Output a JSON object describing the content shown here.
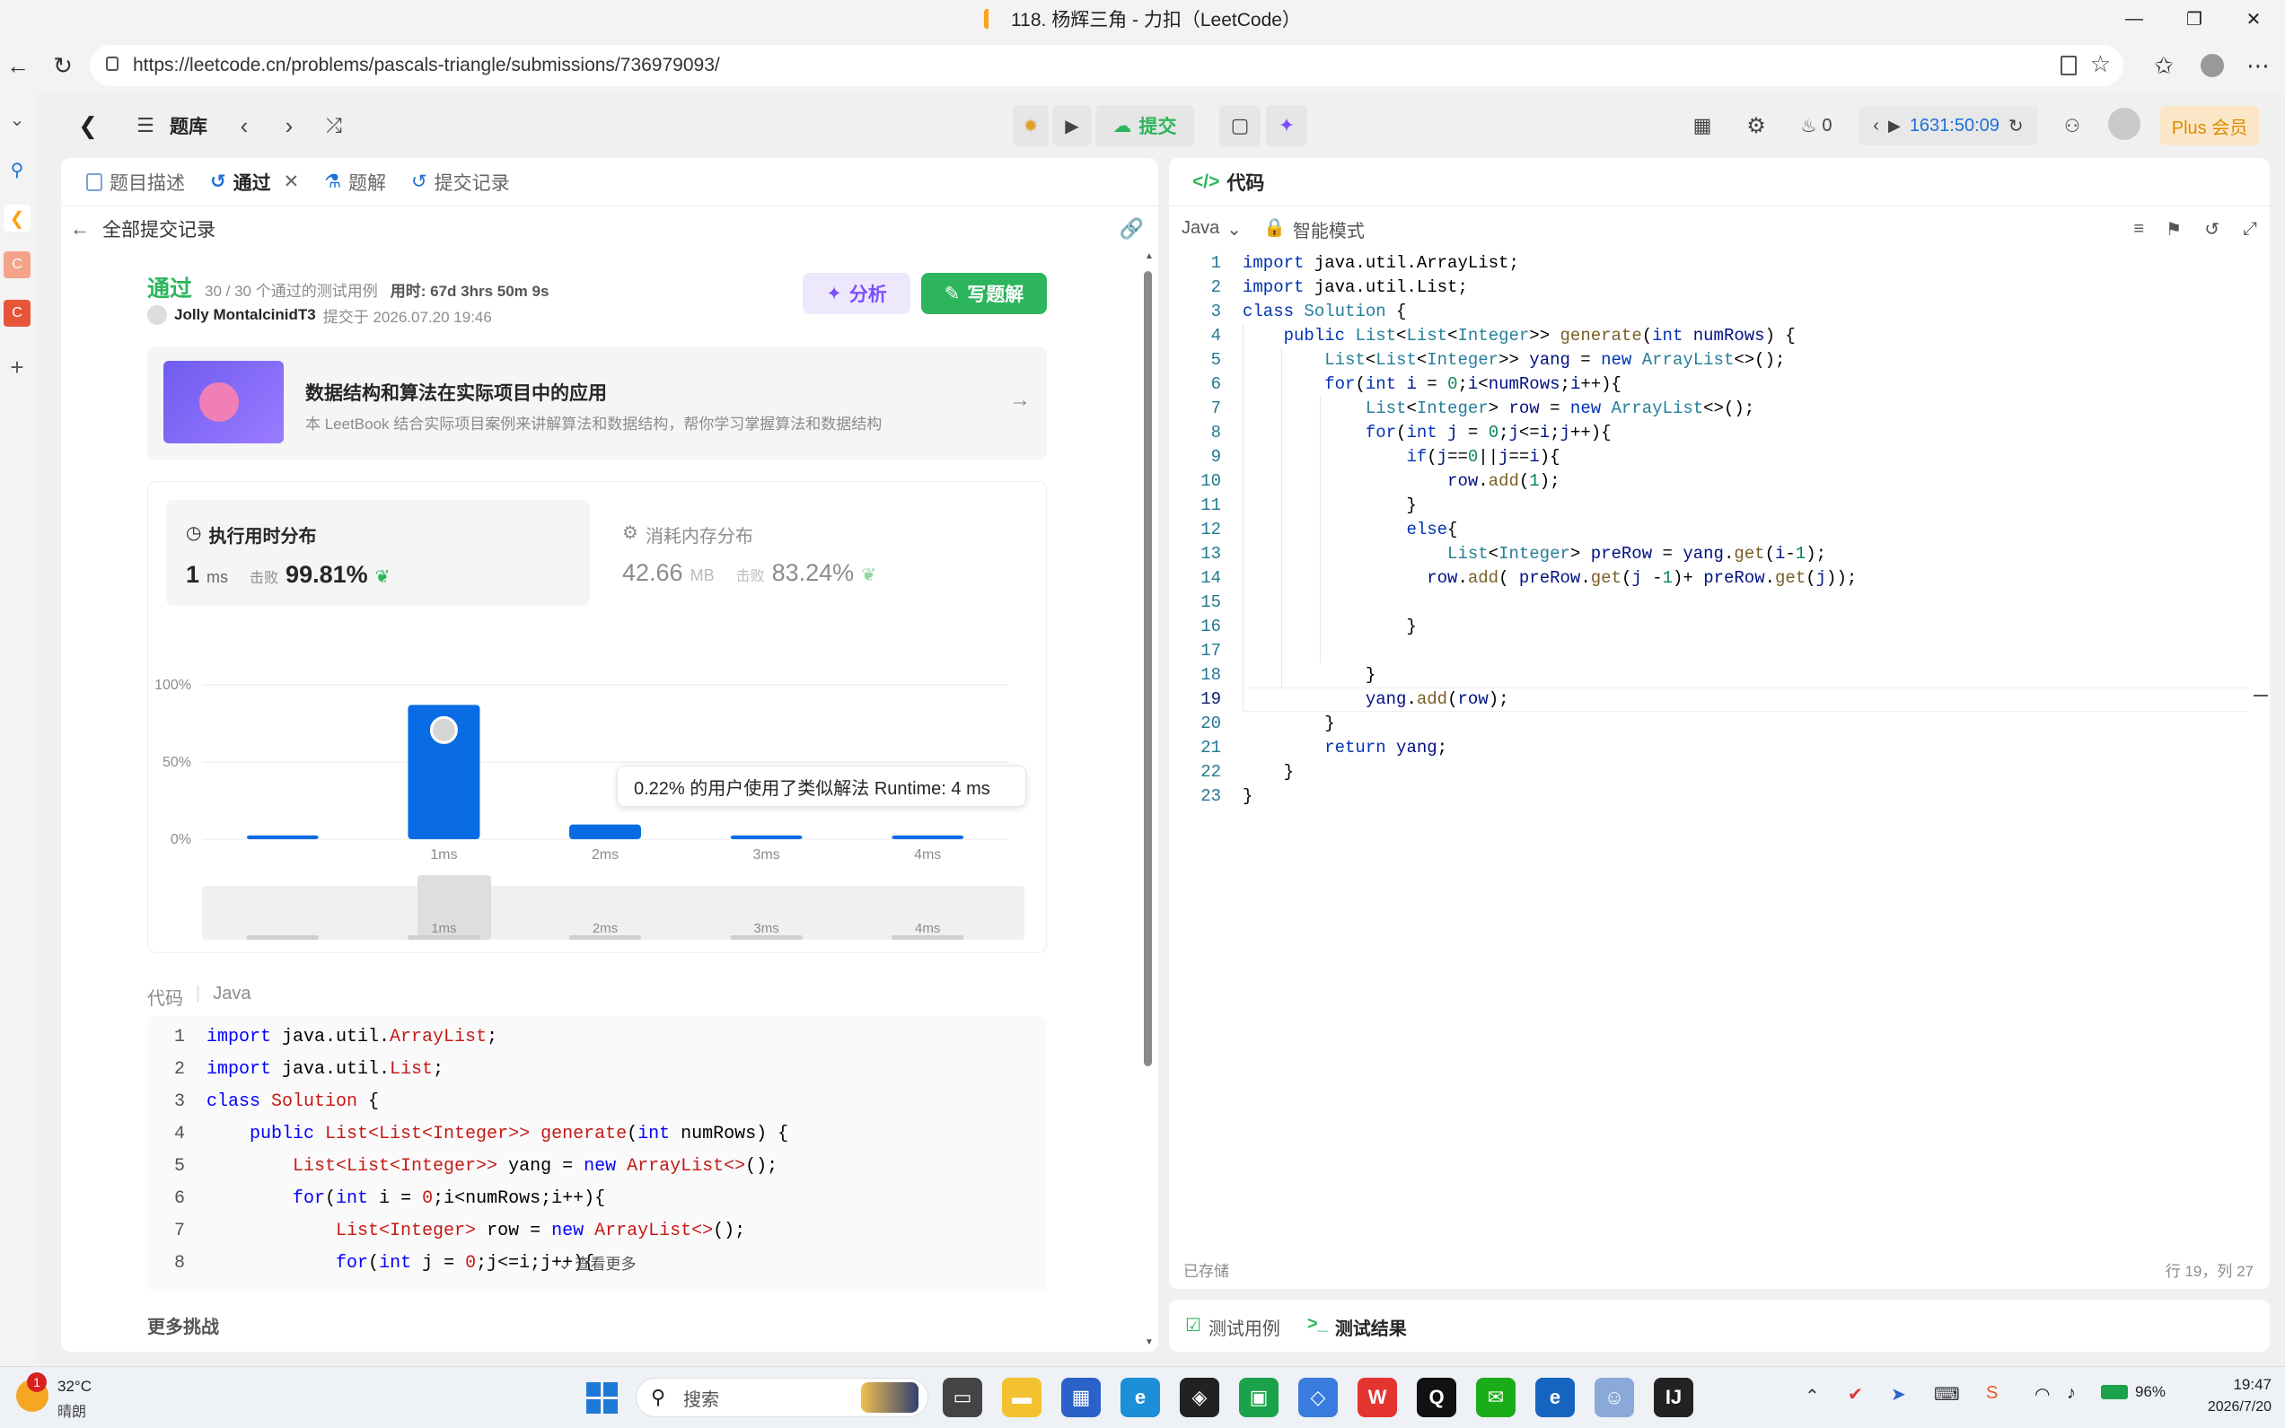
{
  "window": {
    "title": "118. 杨辉三角 - 力扣（LeetCode）"
  },
  "browser": {
    "url": "https://leetcode.cn/problems/pascals-triangle/submissions/736979093/"
  },
  "header": {
    "problem_list": "题库",
    "submit": "提交",
    "streak_count": "0",
    "timer": "1631:50:09",
    "plus": "Plus 会员"
  },
  "left_tabs": [
    {
      "label": "题目描述"
    },
    {
      "label": "通过"
    },
    {
      "label": "题解"
    },
    {
      "label": "提交记录"
    }
  ],
  "submission": {
    "back_label": "全部提交记录",
    "status": "通过",
    "tests": "30 / 30 个通过的测试用例",
    "duration": "用时: 67d 3hrs 50m 9s",
    "user": "Jolly MontalcinidT3",
    "submitted_at": "提交于 2026.07.20 19:46",
    "analyze": "分析",
    "write_solution": "写题解"
  },
  "banner": {
    "title": "数据结构和算法在实际项目中的应用",
    "desc": "本 LeetBook 结合实际项目案例来讲解算法和数据结构，帮你学习掌握算法和数据结构"
  },
  "runtime": {
    "title": "执行用时分布",
    "value": "1",
    "unit": "ms",
    "beat_label": "击败",
    "beat": "99.81%"
  },
  "memory": {
    "title": "消耗内存分布",
    "value": "42.66",
    "unit": "MB",
    "beat_label": "击败",
    "beat": "83.24%"
  },
  "tooltip": "0.22% 的用户使用了类似解法 Runtime: 4 ms",
  "chart_data": {
    "type": "bar",
    "categories": [
      "",
      "1ms",
      "2ms",
      "3ms",
      "4ms"
    ],
    "values": [
      2.5,
      87,
      9.5,
      2.5,
      2.5
    ],
    "y_ticks": [
      "100%",
      "50%",
      "0%"
    ],
    "ylim": [
      0,
      100
    ],
    "grid": true,
    "brush_labels": [
      "1ms",
      "2ms",
      "3ms",
      "4ms"
    ]
  },
  "code_section": {
    "label": "代码",
    "lang": "Java",
    "more": "查看更多"
  },
  "code_preview": [
    {
      "n": "1",
      "t": [
        [
          "kw",
          "import "
        ],
        [
          "pl",
          "java.util."
        ],
        [
          "ty",
          "ArrayList"
        ],
        [
          "pl",
          ";"
        ]
      ]
    },
    {
      "n": "2",
      "t": [
        [
          "kw",
          "import "
        ],
        [
          "pl",
          "java.util."
        ],
        [
          "ty",
          "List"
        ],
        [
          "pl",
          ";"
        ]
      ]
    },
    {
      "n": "3",
      "t": [
        [
          "kw",
          "class "
        ],
        [
          "ty",
          "Solution"
        ],
        [
          "pl",
          " {"
        ]
      ]
    },
    {
      "n": "4",
      "t": [
        [
          "pl",
          "    "
        ],
        [
          "kw",
          "public "
        ],
        [
          "ty",
          "List<List<Integer>> "
        ],
        [
          "ty",
          "generate"
        ],
        [
          "pl",
          "("
        ],
        [
          "kw",
          "int "
        ],
        [
          "pl",
          "numRows) {"
        ]
      ]
    },
    {
      "n": "5",
      "t": [
        [
          "pl",
          "        "
        ],
        [
          "ty",
          "List<List<Integer>> "
        ],
        [
          "pl",
          "yang = "
        ],
        [
          "kw",
          "new "
        ],
        [
          "ty",
          "ArrayList<>"
        ],
        [
          "pl",
          "();"
        ]
      ]
    },
    {
      "n": "6",
      "t": [
        [
          "pl",
          "        "
        ],
        [
          "kw",
          "for"
        ],
        [
          "pl",
          "("
        ],
        [
          "kw",
          "int "
        ],
        [
          "pl",
          "i = "
        ],
        [
          "ty",
          "0"
        ],
        [
          "pl",
          ";i<numRows;i++){"
        ]
      ]
    },
    {
      "n": "7",
      "t": [
        [
          "pl",
          "            "
        ],
        [
          "ty",
          "List<Integer> "
        ],
        [
          "pl",
          "row = "
        ],
        [
          "kw",
          "new "
        ],
        [
          "ty",
          "ArrayList<>"
        ],
        [
          "pl",
          "();"
        ]
      ]
    },
    {
      "n": "8",
      "t": [
        [
          "pl",
          "            "
        ],
        [
          "kw",
          "for"
        ],
        [
          "pl",
          "("
        ],
        [
          "kw",
          "int "
        ],
        [
          "pl",
          "j = "
        ],
        [
          "ty",
          "0"
        ],
        [
          "pl",
          ";j<=i;j++){"
        ]
      ]
    }
  ],
  "more_challenges": "更多挑战",
  "editor": {
    "tab": "代码",
    "lang": "Java",
    "mode": "智能模式",
    "saved": "已存储",
    "cursor": "行 19，列 27",
    "lines": [
      {
        "n": "1",
        "t": [
          [
            "kw2",
            "import "
          ],
          [
            "pl",
            "java.util.ArrayList;"
          ]
        ]
      },
      {
        "n": "2",
        "t": [
          [
            "kw2",
            "import "
          ],
          [
            "pl",
            "java.util.List;"
          ]
        ]
      },
      {
        "n": "3",
        "t": [
          [
            "kw2",
            "class "
          ],
          [
            "ty2",
            "Solution"
          ],
          [
            "pl",
            " {"
          ]
        ]
      },
      {
        "n": "4",
        "t": [
          [
            "pl",
            "    "
          ],
          [
            "kw2",
            "public "
          ],
          [
            "ty2",
            "List"
          ],
          [
            "pl",
            "<"
          ],
          [
            "ty2",
            "List"
          ],
          [
            "pl",
            "<"
          ],
          [
            "ty2",
            "Integer"
          ],
          [
            "pl",
            ">> "
          ],
          [
            "fn2",
            "generate"
          ],
          [
            "pl",
            "("
          ],
          [
            "kw2",
            "int "
          ],
          [
            "vr2",
            "numRows"
          ],
          [
            "pl",
            ") {"
          ]
        ]
      },
      {
        "n": "5",
        "t": [
          [
            "pl",
            "        "
          ],
          [
            "ty2",
            "List"
          ],
          [
            "pl",
            "<"
          ],
          [
            "ty2",
            "List"
          ],
          [
            "pl",
            "<"
          ],
          [
            "ty2",
            "Integer"
          ],
          [
            "pl",
            ">> "
          ],
          [
            "vr2",
            "yang"
          ],
          [
            "pl",
            " = "
          ],
          [
            "kw2",
            "new "
          ],
          [
            "ty2",
            "ArrayList"
          ],
          [
            "pl",
            "<>();"
          ]
        ]
      },
      {
        "n": "6",
        "t": [
          [
            "pl",
            "        "
          ],
          [
            "kw2",
            "for"
          ],
          [
            "pl",
            "("
          ],
          [
            "kw2",
            "int "
          ],
          [
            "vr2",
            "i"
          ],
          [
            "pl",
            " = "
          ],
          [
            "nm2",
            "0"
          ],
          [
            "pl",
            ";"
          ],
          [
            "vr2",
            "i"
          ],
          [
            "pl",
            "<"
          ],
          [
            "vr2",
            "numRows"
          ],
          [
            "pl",
            ";"
          ],
          [
            "vr2",
            "i"
          ],
          [
            "pl",
            "++){"
          ]
        ]
      },
      {
        "n": "7",
        "t": [
          [
            "pl",
            "            "
          ],
          [
            "ty2",
            "List"
          ],
          [
            "pl",
            "<"
          ],
          [
            "ty2",
            "Integer"
          ],
          [
            "pl",
            "> "
          ],
          [
            "vr2",
            "row"
          ],
          [
            "pl",
            " = "
          ],
          [
            "kw2",
            "new "
          ],
          [
            "ty2",
            "ArrayList"
          ],
          [
            "pl",
            "<>();"
          ]
        ]
      },
      {
        "n": "8",
        "t": [
          [
            "pl",
            "            "
          ],
          [
            "kw2",
            "for"
          ],
          [
            "pl",
            "("
          ],
          [
            "kw2",
            "int "
          ],
          [
            "vr2",
            "j"
          ],
          [
            "pl",
            " = "
          ],
          [
            "nm2",
            "0"
          ],
          [
            "pl",
            ";"
          ],
          [
            "vr2",
            "j"
          ],
          [
            "pl",
            "<="
          ],
          [
            "vr2",
            "i"
          ],
          [
            "pl",
            ";"
          ],
          [
            "vr2",
            "j"
          ],
          [
            "pl",
            "++){"
          ]
        ]
      },
      {
        "n": "9",
        "t": [
          [
            "pl",
            "                "
          ],
          [
            "kw2",
            "if"
          ],
          [
            "pl",
            "("
          ],
          [
            "vr2",
            "j"
          ],
          [
            "pl",
            "=="
          ],
          [
            "nm2",
            "0"
          ],
          [
            "pl",
            "||"
          ],
          [
            "vr2",
            "j"
          ],
          [
            "pl",
            "=="
          ],
          [
            "vr2",
            "i"
          ],
          [
            "pl",
            "){"
          ]
        ]
      },
      {
        "n": "10",
        "t": [
          [
            "pl",
            "                    "
          ],
          [
            "vr2",
            "row"
          ],
          [
            "pl",
            "."
          ],
          [
            "fn2",
            "add"
          ],
          [
            "pl",
            "("
          ],
          [
            "nm2",
            "1"
          ],
          [
            "pl",
            ");"
          ]
        ]
      },
      {
        "n": "11",
        "t": [
          [
            "pl",
            "                }"
          ]
        ]
      },
      {
        "n": "12",
        "t": [
          [
            "pl",
            "                "
          ],
          [
            "kw2",
            "else"
          ],
          [
            "pl",
            "{"
          ]
        ]
      },
      {
        "n": "13",
        "t": [
          [
            "pl",
            "                    "
          ],
          [
            "ty2",
            "List"
          ],
          [
            "pl",
            "<"
          ],
          [
            "ty2",
            "Integer"
          ],
          [
            "pl",
            "> "
          ],
          [
            "vr2",
            "preRow"
          ],
          [
            "pl",
            " = "
          ],
          [
            "vr2",
            "yang"
          ],
          [
            "pl",
            "."
          ],
          [
            "fn2",
            "get"
          ],
          [
            "pl",
            "("
          ],
          [
            "vr2",
            "i"
          ],
          [
            "pl",
            "-"
          ],
          [
            "nm2",
            "1"
          ],
          [
            "pl",
            ");"
          ]
        ]
      },
      {
        "n": "14",
        "t": [
          [
            "pl",
            "                  "
          ],
          [
            "vr2",
            "row"
          ],
          [
            "pl",
            "."
          ],
          [
            "fn2",
            "add"
          ],
          [
            "pl",
            "( "
          ],
          [
            "vr2",
            "preRow"
          ],
          [
            "pl",
            "."
          ],
          [
            "fn2",
            "get"
          ],
          [
            "pl",
            "("
          ],
          [
            "vr2",
            "j"
          ],
          [
            "pl",
            " -"
          ],
          [
            "nm2",
            "1"
          ],
          [
            "pl",
            ")+ "
          ],
          [
            "vr2",
            "preRow"
          ],
          [
            "pl",
            "."
          ],
          [
            "fn2",
            "get"
          ],
          [
            "pl",
            "("
          ],
          [
            "vr2",
            "j"
          ],
          [
            "pl",
            "));"
          ]
        ]
      },
      {
        "n": "15",
        "t": [
          [
            "pl",
            ""
          ]
        ]
      },
      {
        "n": "16",
        "t": [
          [
            "pl",
            "                }"
          ]
        ]
      },
      {
        "n": "17",
        "t": [
          [
            "pl",
            ""
          ]
        ]
      },
      {
        "n": "18",
        "t": [
          [
            "pl",
            "            }"
          ]
        ]
      },
      {
        "n": "19",
        "t": [
          [
            "pl",
            "            "
          ],
          [
            "vr2",
            "yang"
          ],
          [
            "pl",
            "."
          ],
          [
            "fn2",
            "add"
          ],
          [
            "pl",
            "("
          ],
          [
            "vr2",
            "row"
          ],
          [
            "pl",
            ");"
          ]
        ]
      },
      {
        "n": "20",
        "t": [
          [
            "pl",
            "        }"
          ]
        ]
      },
      {
        "n": "21",
        "t": [
          [
            "pl",
            "        "
          ],
          [
            "kw2",
            "return "
          ],
          [
            "vr2",
            "yang"
          ],
          [
            "pl",
            ";"
          ]
        ]
      },
      {
        "n": "22",
        "t": [
          [
            "pl",
            "    }"
          ]
        ]
      },
      {
        "n": "23",
        "t": [
          [
            "pl",
            "}"
          ]
        ]
      }
    ]
  },
  "bottom_tabs": {
    "testcase": "测试用例",
    "result": "测试结果"
  },
  "taskbar": {
    "weather_temp": "32°C",
    "weather_desc": "晴朗",
    "weather_badge": "1",
    "search": "搜索",
    "battery": "96%",
    "time": "19:47",
    "date": "2026/7/20"
  },
  "colors": {
    "accent_green": "#2db55d",
    "bar_blue": "#0a6ce4",
    "purple": "#7c4dff"
  }
}
